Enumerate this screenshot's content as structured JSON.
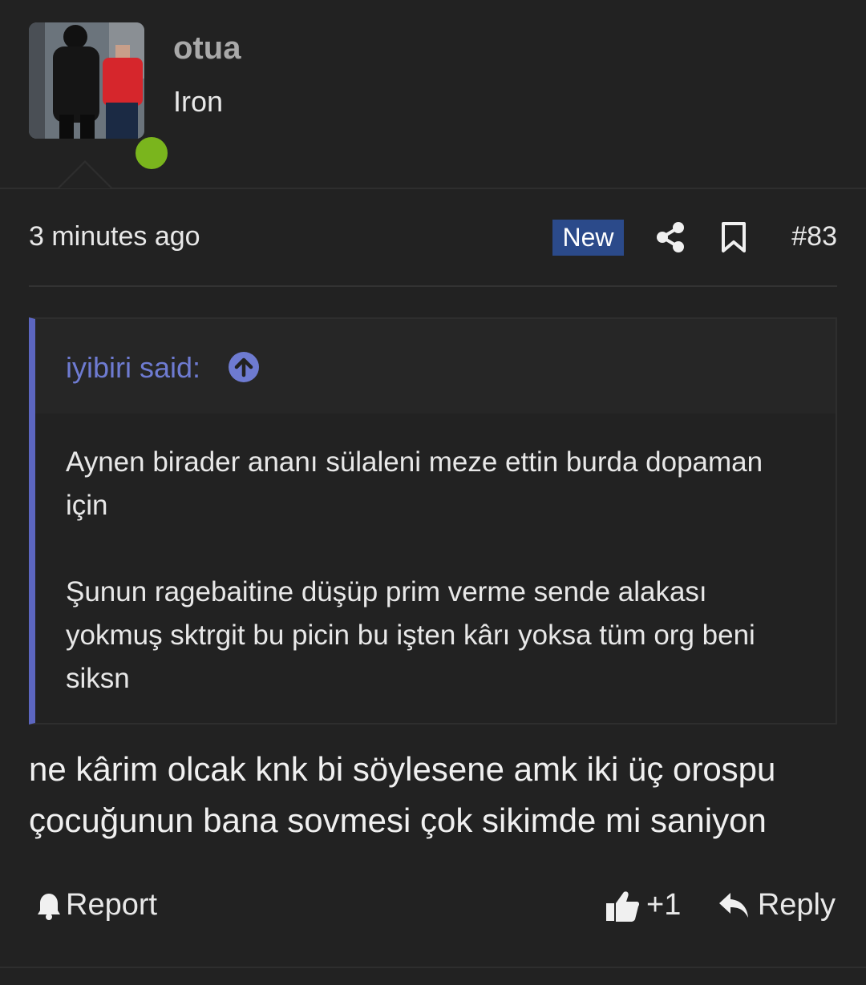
{
  "user": {
    "name": "otua",
    "title": "Iron",
    "online": true
  },
  "post": {
    "time": "3 minutes ago",
    "badge": "New",
    "number": "#83",
    "quote": {
      "author": "iyibiri said:",
      "paragraphs": [
        "Aynen birader ananı sülaleni meze ettin burda dopaman için",
        "Şunun ragebaitine düşüp prim verme sende alakası yokmuş sktrgit bu picin bu işten kârı yoksa tüm org beni siksn"
      ]
    },
    "message": "ne kârim olcak knk bi söylesene amk iki üç orospu çocuğunun bana sovmesi çok sikimde mi saniyon",
    "actions": {
      "report": "Report",
      "like_count": "+1",
      "reply": "Reply"
    }
  },
  "colors": {
    "background": "#222222",
    "badge": "#2b4a8a",
    "quote_accent": "#5c66c0",
    "online": "#7ab51d"
  }
}
